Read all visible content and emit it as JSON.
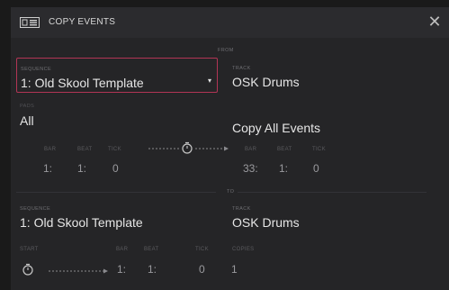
{
  "dialog": {
    "title": "COPY EVENTS",
    "close": "✕"
  },
  "section_from": "FROM",
  "section_to": "TO",
  "from": {
    "sequence_label": "SEQUENCE",
    "sequence_value": "1: Old Skool Template",
    "track_label": "TRACK",
    "track_value": "OSK Drums",
    "pads_label": "PADS",
    "pads_value": "All",
    "events_value": "Copy All Events",
    "start": {
      "bar_label": "BAR",
      "beat_label": "BEAT",
      "tick_label": "TICK",
      "bar": "1:",
      "beat": "1:",
      "tick": "0"
    },
    "end": {
      "bar_label": "BAR",
      "beat_label": "BEAT",
      "tick_label": "TICK",
      "bar": "33:",
      "beat": "1:",
      "tick": "0"
    }
  },
  "to": {
    "sequence_label": "SEQUENCE",
    "sequence_value": "1: Old Skool Template",
    "track_label": "TRACK",
    "track_value": "OSK Drums",
    "start_label": "START",
    "bar_label": "BAR",
    "beat_label": "BEAT",
    "tick_label": "TICK",
    "copies_label": "COPIES",
    "bar": "1:",
    "beat": "1:",
    "tick": "0",
    "copies": "1"
  },
  "colors": {
    "accent": "#b23555",
    "background": "#252527",
    "text": "#e6e6e6"
  },
  "icons": {
    "title": "copy-events-icon",
    "timer": "stopwatch-icon",
    "close": "close-icon"
  }
}
